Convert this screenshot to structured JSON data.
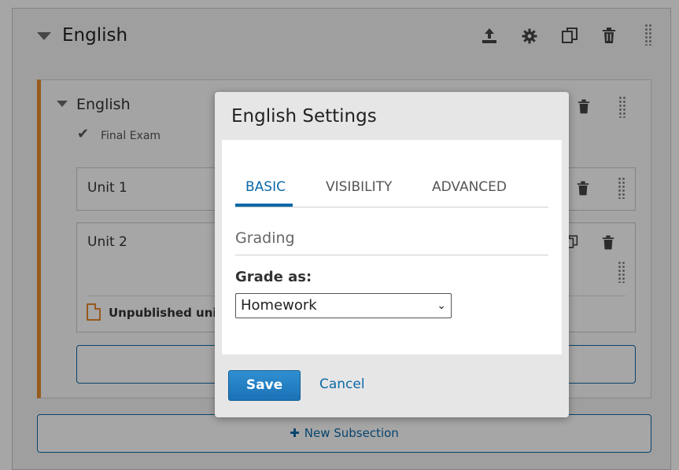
{
  "section": {
    "title": "English",
    "icons": [
      "upload-icon",
      "gear-icon",
      "duplicate-icon",
      "trash-icon",
      "drag-handle-icon"
    ]
  },
  "subsection": {
    "title": "English",
    "grading_label": "Final Exam",
    "units": [
      {
        "label": "Unit 1"
      },
      {
        "label": "Unit 2"
      }
    ],
    "unpublished_text": "Unpublished units"
  },
  "new_subsection_label": "New Subsection",
  "modal": {
    "title": "English Settings",
    "tabs": [
      {
        "label": "BASIC",
        "active": true
      },
      {
        "label": "VISIBILITY",
        "active": false
      },
      {
        "label": "ADVANCED",
        "active": false
      }
    ],
    "section_heading": "Grading",
    "grade_as_label": "Grade as:",
    "grade_as_value": "Homework",
    "save_label": "Save",
    "cancel_label": "Cancel"
  },
  "colors": {
    "accent": "#0b69a8",
    "warning": "#e88a2f"
  }
}
